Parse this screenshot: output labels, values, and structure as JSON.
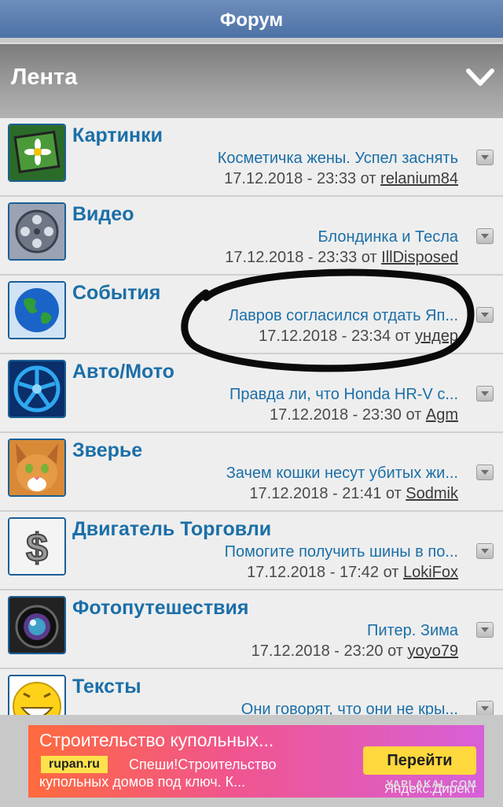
{
  "header": {
    "title": "Форум"
  },
  "section": {
    "title": "Лента"
  },
  "rows": [
    {
      "category": "Картинки",
      "topic": "Косметичка жены. Успел заснять",
      "datetime": "17.12.2018 - 23:33",
      "from": "от",
      "user": "relanium84",
      "icon": "daisy-picture-icon"
    },
    {
      "category": "Видео",
      "topic": "Блондинка и Тесла",
      "datetime": "17.12.2018 - 23:33",
      "from": "от",
      "user": "IllDisposed",
      "icon": "film-reel-icon"
    },
    {
      "category": "События",
      "topic": "Лавров согласился отдать Яп...",
      "datetime": "17.12.2018 - 23:34",
      "from": "от",
      "user": "ундер",
      "icon": "globe-icon"
    },
    {
      "category": "Авто/Мото",
      "topic": "Правда ли, что Honda HR-V с...",
      "datetime": "17.12.2018 - 23:30",
      "from": "от",
      "user": "Agm",
      "icon": "wheel-rim-icon"
    },
    {
      "category": "Зверье",
      "topic": "Зачем кошки несут убитых жи...",
      "datetime": "17.12.2018 - 21:41",
      "from": "от",
      "user": "Sodmik",
      "icon": "cat-icon"
    },
    {
      "category": "Двигатель Торговли",
      "topic": "Помогите получить шины в по...",
      "datetime": "17.12.2018 - 17:42",
      "from": "от",
      "user": "LokiFox",
      "icon": "dollar-icon"
    },
    {
      "category": "Фотопутешествия",
      "topic": "Питер. Зима",
      "datetime": "17.12.2018 - 23:20",
      "from": "от",
      "user": "yoyo79",
      "icon": "camera-lens-icon"
    },
    {
      "category": "Тексты",
      "topic": "Они говорят, что они не кры...",
      "datetime": "",
      "from": "",
      "user": "",
      "icon": "smiley-icon"
    }
  ],
  "ad": {
    "title": "Строительство купольных...",
    "domain": "rupan.ru",
    "text_line1": "Спеши!Строительство",
    "text_line2": "купольных домов под ключ. К...",
    "button": "Перейти",
    "source": "Яндекс.Директ"
  },
  "watermark": "YAPLAKAL.COM",
  "colors": {
    "header_blue": "#5a7db1",
    "link_blue": "#1b6fa8",
    "ad_orange": "#ff6a3d",
    "ad_purple": "#d760d8",
    "ad_button": "#ffd83d"
  }
}
